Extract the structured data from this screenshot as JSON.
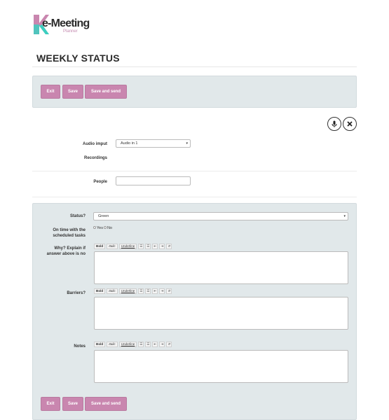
{
  "brand": {
    "name": "e-Meeting",
    "sub": "Planner",
    "colors": {
      "pink": "#c986af",
      "teal": "#3ccfc0"
    }
  },
  "page_title": "WEEKLY STATUS",
  "top_buttons": {
    "exit": "Exit",
    "save": "Save",
    "save_send": "Save and send"
  },
  "bottom_buttons": {
    "exit": "Exit",
    "save": "Save",
    "save_send": "Save and send"
  },
  "audio": {
    "label": "Audio imput",
    "value": "Audio in 1",
    "recordings_label": "Recordings"
  },
  "people": {
    "label": "People",
    "value": ""
  },
  "status": {
    "label": "Status?",
    "value": "Green"
  },
  "on_time": {
    "label_line1": "On time with the",
    "label_line2": "scheduled tasks",
    "yes": "Yes",
    "no": "No"
  },
  "why": {
    "label_line1": "Why? Explain if",
    "label_line2": "answer above is no"
  },
  "barriers": {
    "label": "Barriers?"
  },
  "notes": {
    "label": "Notes"
  },
  "editor_toolbar": {
    "bold": "Bold",
    "italic": "Italic",
    "underline": "Underline"
  }
}
